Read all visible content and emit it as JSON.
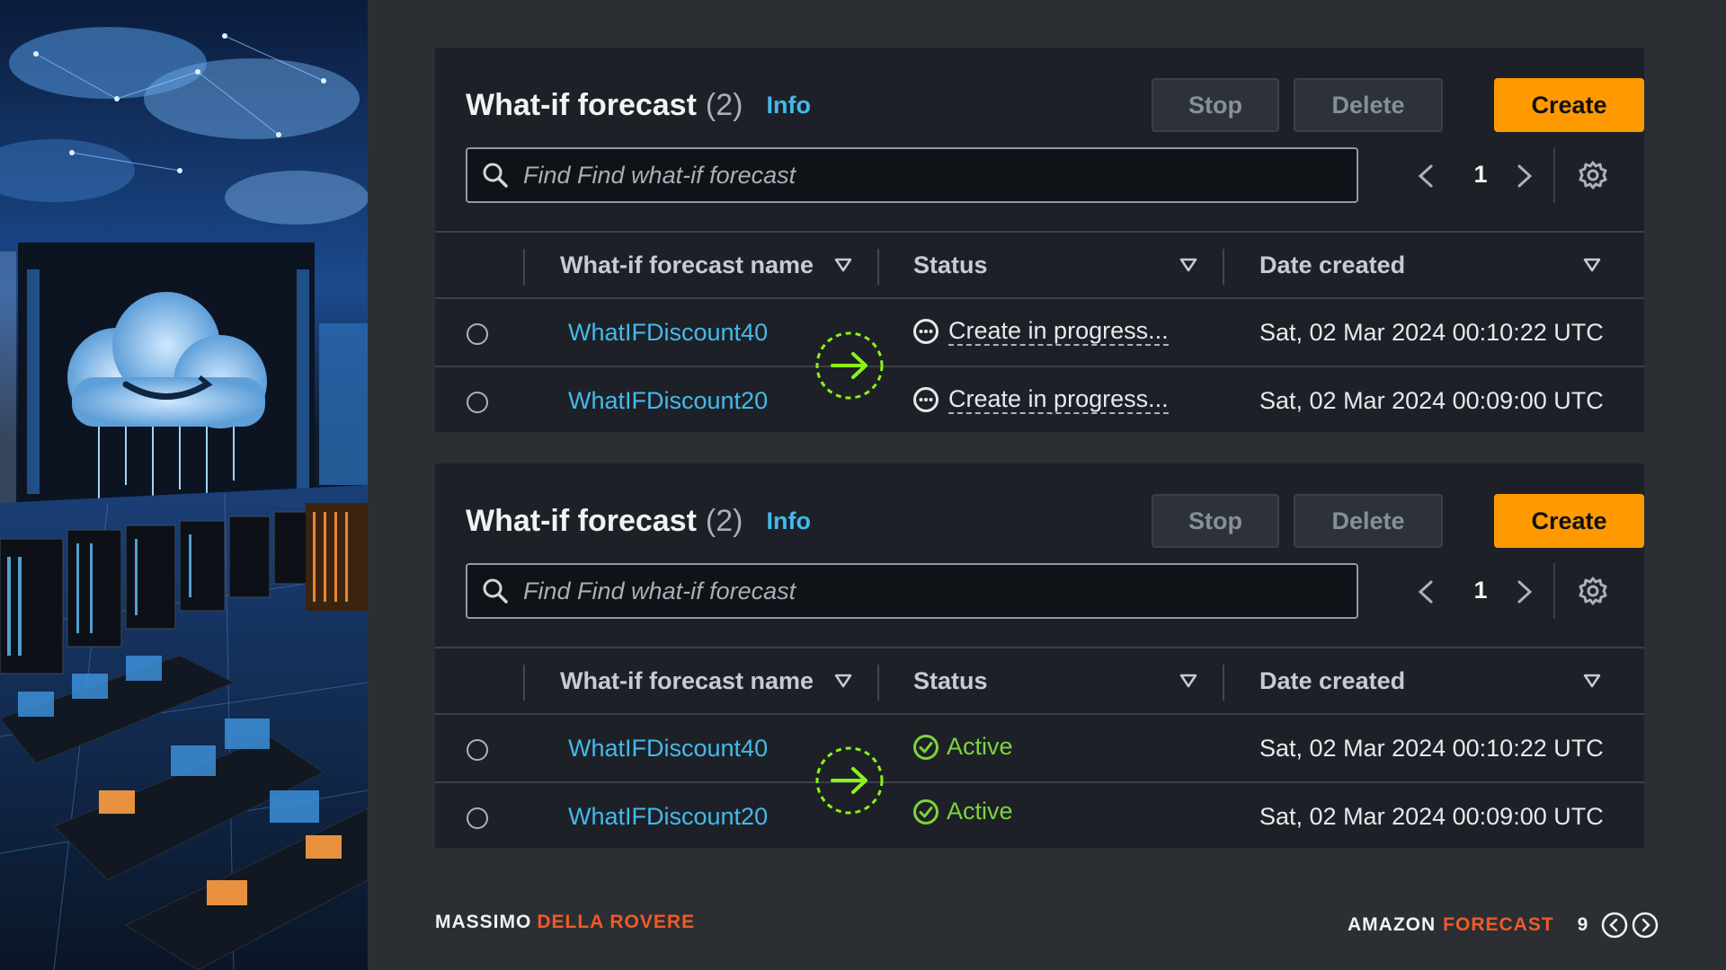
{
  "footer": {
    "author_first": "MASSIMO",
    "author_last": "DELLA ROVERE",
    "brand_first": "AMAZON",
    "brand_second": "FORECAST",
    "page_number": "9"
  },
  "colors": {
    "accent_orange": "#ff9900",
    "link_blue": "#44b9ea",
    "success_green": "#7ed33a",
    "footer_red": "#f05a28",
    "arrow_green": "#8bf21b"
  },
  "panels": [
    {
      "title": "What-if forecast",
      "count": "2",
      "info_label": "Info",
      "buttons": {
        "stop": "Stop",
        "delete": "Delete",
        "create": "Create"
      },
      "search": {
        "placeholder": "Find Find what-if forecast",
        "value": ""
      },
      "pager": {
        "page": "1"
      },
      "columns": [
        "What-if forecast name",
        "Status",
        "Date created"
      ],
      "rows": [
        {
          "name": "WhatIFDiscount40",
          "status": "Create in progress...",
          "status_type": "in-progress",
          "date": "Sat, 02 Mar 2024 00:10:22 UTC"
        },
        {
          "name": "WhatIFDiscount20",
          "status": "Create in progress...",
          "status_type": "in-progress",
          "date": "Sat, 02 Mar 2024 00:09:00 UTC"
        }
      ]
    },
    {
      "title": "What-if forecast",
      "count": "2",
      "info_label": "Info",
      "buttons": {
        "stop": "Stop",
        "delete": "Delete",
        "create": "Create"
      },
      "search": {
        "placeholder": "Find Find what-if forecast",
        "value": ""
      },
      "pager": {
        "page": "1"
      },
      "columns": [
        "What-if forecast name",
        "Status",
        "Date created"
      ],
      "rows": [
        {
          "name": "WhatIFDiscount40",
          "status": "Active",
          "status_type": "active",
          "date": "Sat, 02 Mar 2024 00:10:22 UTC"
        },
        {
          "name": "WhatIFDiscount20",
          "status": "Active",
          "status_type": "active",
          "date": "Sat, 02 Mar 2024 00:09:00 UTC"
        }
      ]
    }
  ]
}
